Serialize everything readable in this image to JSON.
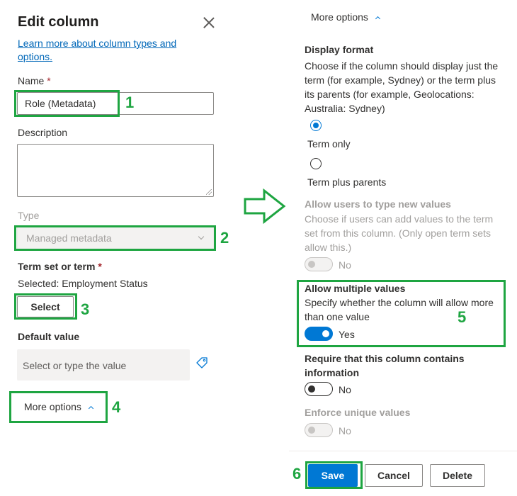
{
  "panel": {
    "title": "Edit column",
    "learn_more": "Learn more about column types and options."
  },
  "fields": {
    "name_label": "Name",
    "required_mark": "*",
    "name_value": "Role (Metadata)",
    "description_label": "Description",
    "type_label": "Type",
    "type_value": "Managed metadata",
    "termset_label": "Term set or term",
    "termset_selected": "Selected: Employment Status",
    "select_button": "Select",
    "default_label": "Default value",
    "default_placeholder": "Select or type the value",
    "more_options": "More options"
  },
  "options": {
    "more_options": "More options",
    "display_format_title": "Display format",
    "display_format_desc": "Choose if the column should display just the term (for example, Sydney) or the term plus its parents (for example, Geolocations: Australia: Sydney)",
    "radio_term_only": "Term only",
    "radio_term_parents": "Term plus parents",
    "allow_new_title": "Allow users to type new values",
    "allow_new_desc": "Choose if users can add values to the term set from this column. (Only open term sets allow this.)",
    "allow_new_state": "No",
    "multi_title": "Allow multiple values",
    "multi_desc": "Specify whether the column will allow more than one value",
    "multi_state": "Yes",
    "require_title": "Require that this column contains information",
    "require_state": "No",
    "unique_title": "Enforce unique values",
    "unique_state": "No"
  },
  "footer": {
    "save": "Save",
    "cancel": "Cancel",
    "delete": "Delete"
  },
  "annotations": {
    "n1": "1",
    "n2": "2",
    "n3": "3",
    "n4": "4",
    "n5": "5",
    "n6": "6"
  },
  "colors": {
    "highlight": "#1ea541",
    "accent": "#0078d4"
  }
}
